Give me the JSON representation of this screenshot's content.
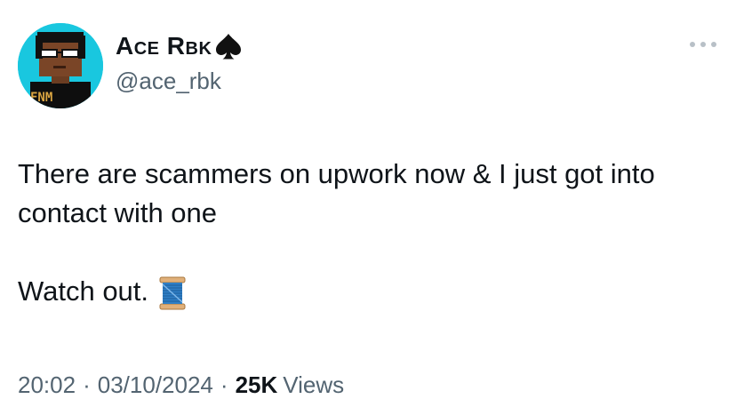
{
  "author": {
    "display_name": "Ace Rbk",
    "handle": "@ace_rbk",
    "avatar_text": "FNM"
  },
  "tweet": {
    "line1": "There are scammers on upwork now & I just got into contact with one",
    "line2": "Watch out.",
    "emoji": "thread-spool-icon"
  },
  "meta": {
    "time": "20:02",
    "date": "03/10/2024",
    "separator": "·",
    "views_count": "25K",
    "views_label": "Views"
  },
  "colors": {
    "text": "#0f1419",
    "secondary": "#536471",
    "avatar_bg": "#19c7df"
  }
}
